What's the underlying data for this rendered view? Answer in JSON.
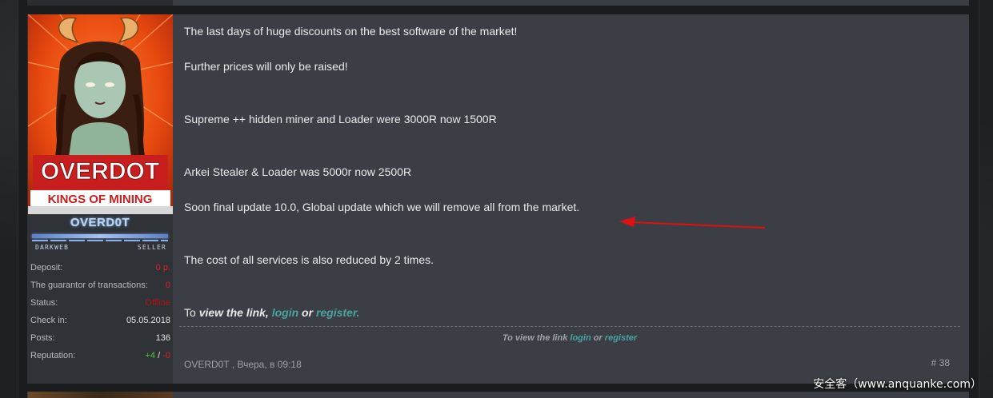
{
  "colors": {
    "accent_link": "#4aa5a0",
    "post_bg": "#3b3e44",
    "sidebar_bg": "#2f3236",
    "deposit_red": "#e02222",
    "reputation_positive": "#44cc33",
    "arrow_red": "#e01010"
  },
  "sidebar": {
    "avatar": {
      "title": "OVERDOT",
      "subtitle": "KINGS OF MINING",
      "icon": "avatar-image"
    },
    "username": "OVERD0T",
    "rank_left": "DARKWEB",
    "rank_right": "SELLER",
    "info": [
      {
        "label": "Deposit:",
        "value": "0 р."
      },
      {
        "label": "The guarantor of transactions:",
        "value": "0"
      },
      {
        "label": "Status:",
        "value": "Offline"
      },
      {
        "label": "Check in:",
        "value": "05.05.2018"
      },
      {
        "label": "Posts:",
        "value": "136"
      }
    ],
    "reputation": {
      "label": "Reputation:",
      "positive": "+4",
      "slash": "/",
      "negative": "-0"
    }
  },
  "message": {
    "lines": [
      "The last days of huge discounts on the best software of the market!",
      "Further prices will only be raised!",
      "Supreme ++ hidden miner and Loader were 3000R now 1500R",
      "Arkei Stealer & Loader was 5000r now 2500R",
      "Soon final update 10.0, Global update which we will remove all from the market.",
      "The cost of all services is also reduced by 2 times."
    ],
    "view_link": {
      "prefix": "To ",
      "bold": "view the link,",
      "login": "login",
      "or": "or",
      "register": "register."
    }
  },
  "hidden_note": {
    "prefix": "To view the link ",
    "login": "login",
    "or": " or ",
    "register": "register"
  },
  "footer": {
    "author_date": "OVERD0T , Вчера, в 09:18",
    "post_number": "# 38"
  },
  "watermark": "安全客（www.anquanke.com）"
}
